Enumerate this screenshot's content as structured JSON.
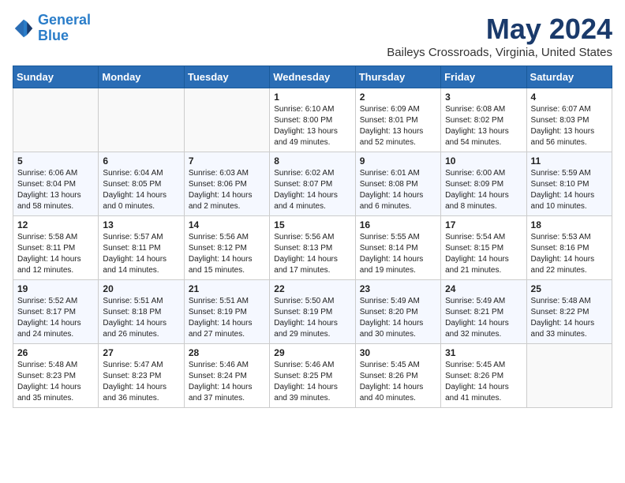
{
  "header": {
    "logo_line1": "General",
    "logo_line2": "Blue",
    "month_title": "May 2024",
    "location": "Baileys Crossroads, Virginia, United States"
  },
  "weekdays": [
    "Sunday",
    "Monday",
    "Tuesday",
    "Wednesday",
    "Thursday",
    "Friday",
    "Saturday"
  ],
  "weeks": [
    [
      {
        "day": "",
        "info": ""
      },
      {
        "day": "",
        "info": ""
      },
      {
        "day": "",
        "info": ""
      },
      {
        "day": "1",
        "info": "Sunrise: 6:10 AM\nSunset: 8:00 PM\nDaylight: 13 hours\nand 49 minutes."
      },
      {
        "day": "2",
        "info": "Sunrise: 6:09 AM\nSunset: 8:01 PM\nDaylight: 13 hours\nand 52 minutes."
      },
      {
        "day": "3",
        "info": "Sunrise: 6:08 AM\nSunset: 8:02 PM\nDaylight: 13 hours\nand 54 minutes."
      },
      {
        "day": "4",
        "info": "Sunrise: 6:07 AM\nSunset: 8:03 PM\nDaylight: 13 hours\nand 56 minutes."
      }
    ],
    [
      {
        "day": "5",
        "info": "Sunrise: 6:06 AM\nSunset: 8:04 PM\nDaylight: 13 hours\nand 58 minutes."
      },
      {
        "day": "6",
        "info": "Sunrise: 6:04 AM\nSunset: 8:05 PM\nDaylight: 14 hours\nand 0 minutes."
      },
      {
        "day": "7",
        "info": "Sunrise: 6:03 AM\nSunset: 8:06 PM\nDaylight: 14 hours\nand 2 minutes."
      },
      {
        "day": "8",
        "info": "Sunrise: 6:02 AM\nSunset: 8:07 PM\nDaylight: 14 hours\nand 4 minutes."
      },
      {
        "day": "9",
        "info": "Sunrise: 6:01 AM\nSunset: 8:08 PM\nDaylight: 14 hours\nand 6 minutes."
      },
      {
        "day": "10",
        "info": "Sunrise: 6:00 AM\nSunset: 8:09 PM\nDaylight: 14 hours\nand 8 minutes."
      },
      {
        "day": "11",
        "info": "Sunrise: 5:59 AM\nSunset: 8:10 PM\nDaylight: 14 hours\nand 10 minutes."
      }
    ],
    [
      {
        "day": "12",
        "info": "Sunrise: 5:58 AM\nSunset: 8:11 PM\nDaylight: 14 hours\nand 12 minutes."
      },
      {
        "day": "13",
        "info": "Sunrise: 5:57 AM\nSunset: 8:11 PM\nDaylight: 14 hours\nand 14 minutes."
      },
      {
        "day": "14",
        "info": "Sunrise: 5:56 AM\nSunset: 8:12 PM\nDaylight: 14 hours\nand 15 minutes."
      },
      {
        "day": "15",
        "info": "Sunrise: 5:56 AM\nSunset: 8:13 PM\nDaylight: 14 hours\nand 17 minutes."
      },
      {
        "day": "16",
        "info": "Sunrise: 5:55 AM\nSunset: 8:14 PM\nDaylight: 14 hours\nand 19 minutes."
      },
      {
        "day": "17",
        "info": "Sunrise: 5:54 AM\nSunset: 8:15 PM\nDaylight: 14 hours\nand 21 minutes."
      },
      {
        "day": "18",
        "info": "Sunrise: 5:53 AM\nSunset: 8:16 PM\nDaylight: 14 hours\nand 22 minutes."
      }
    ],
    [
      {
        "day": "19",
        "info": "Sunrise: 5:52 AM\nSunset: 8:17 PM\nDaylight: 14 hours\nand 24 minutes."
      },
      {
        "day": "20",
        "info": "Sunrise: 5:51 AM\nSunset: 8:18 PM\nDaylight: 14 hours\nand 26 minutes."
      },
      {
        "day": "21",
        "info": "Sunrise: 5:51 AM\nSunset: 8:19 PM\nDaylight: 14 hours\nand 27 minutes."
      },
      {
        "day": "22",
        "info": "Sunrise: 5:50 AM\nSunset: 8:19 PM\nDaylight: 14 hours\nand 29 minutes."
      },
      {
        "day": "23",
        "info": "Sunrise: 5:49 AM\nSunset: 8:20 PM\nDaylight: 14 hours\nand 30 minutes."
      },
      {
        "day": "24",
        "info": "Sunrise: 5:49 AM\nSunset: 8:21 PM\nDaylight: 14 hours\nand 32 minutes."
      },
      {
        "day": "25",
        "info": "Sunrise: 5:48 AM\nSunset: 8:22 PM\nDaylight: 14 hours\nand 33 minutes."
      }
    ],
    [
      {
        "day": "26",
        "info": "Sunrise: 5:48 AM\nSunset: 8:23 PM\nDaylight: 14 hours\nand 35 minutes."
      },
      {
        "day": "27",
        "info": "Sunrise: 5:47 AM\nSunset: 8:23 PM\nDaylight: 14 hours\nand 36 minutes."
      },
      {
        "day": "28",
        "info": "Sunrise: 5:46 AM\nSunset: 8:24 PM\nDaylight: 14 hours\nand 37 minutes."
      },
      {
        "day": "29",
        "info": "Sunrise: 5:46 AM\nSunset: 8:25 PM\nDaylight: 14 hours\nand 39 minutes."
      },
      {
        "day": "30",
        "info": "Sunrise: 5:45 AM\nSunset: 8:26 PM\nDaylight: 14 hours\nand 40 minutes."
      },
      {
        "day": "31",
        "info": "Sunrise: 5:45 AM\nSunset: 8:26 PM\nDaylight: 14 hours\nand 41 minutes."
      },
      {
        "day": "",
        "info": ""
      }
    ]
  ]
}
